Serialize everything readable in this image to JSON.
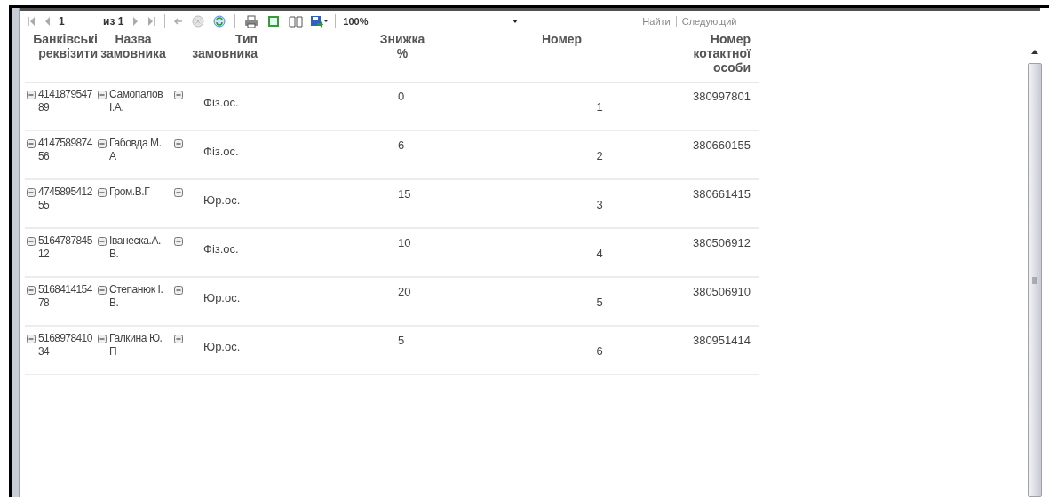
{
  "toolbar": {
    "page": "1",
    "page_count": "из 1",
    "zoom": "100%",
    "find": "Найти",
    "find_next": "Следующий"
  },
  "table": {
    "columns": [
      "Банківські реквізити",
      "Назва замовника",
      "Тип замовника",
      "Знижка %",
      "Номер",
      "Номер котактної особи"
    ],
    "rows": [
      {
        "bank": "414187954789",
        "name": "Самопалов І.А.",
        "type": "Фіз.ос.",
        "discount": "0",
        "number": "1",
        "contact": "380997801"
      },
      {
        "bank": "414758987456",
        "name": "Габовда М.А",
        "type": "Фіз.ос.",
        "discount": "6",
        "number": "2",
        "contact": "380660155"
      },
      {
        "bank": "474589541255",
        "name": "Гром.В.Г",
        "type": "Юр.ос.",
        "discount": "15",
        "number": "3",
        "contact": "380661415"
      },
      {
        "bank": "516478784512",
        "name": "Іванеска.А.В.",
        "type": "Фіз.ос.",
        "discount": "10",
        "number": "4",
        "contact": "380506912"
      },
      {
        "bank": "516841415478",
        "name": "Степанюк І.В.",
        "type": "Юр.ос.",
        "discount": "20",
        "number": "5",
        "contact": "380506910"
      },
      {
        "bank": "516897841034",
        "name": "Галкина Ю.П",
        "type": "Юр.ос.",
        "discount": "5",
        "number": "6",
        "contact": "380951414"
      }
    ]
  }
}
